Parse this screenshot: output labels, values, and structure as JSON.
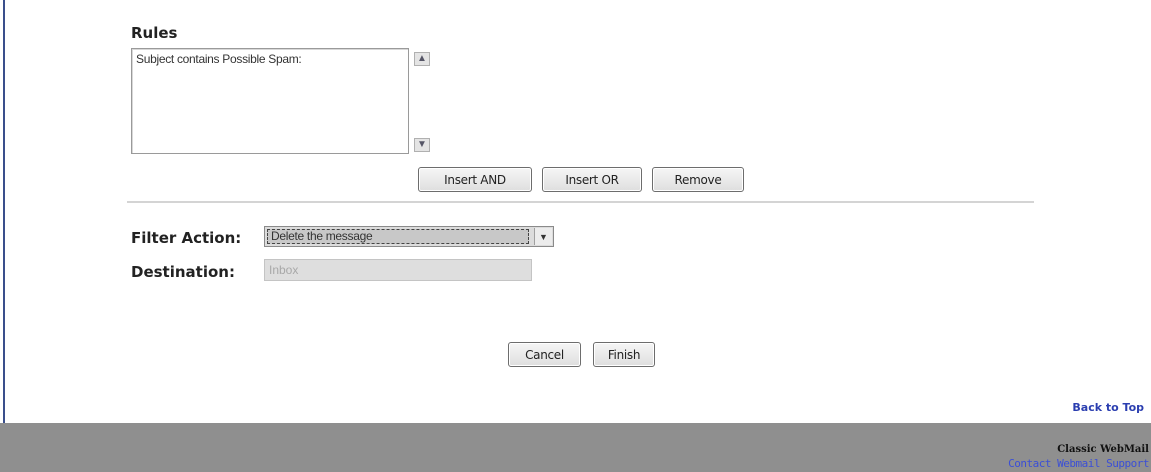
{
  "rules": {
    "title": "Rules",
    "items": [
      "Subject contains Possible Spam:"
    ],
    "scroll_up_icon": "chevron-up-icon",
    "scroll_down_icon": "chevron-down-icon"
  },
  "rule_buttons": {
    "insert_and": "Insert AND",
    "insert_or": "Insert OR",
    "remove": "Remove"
  },
  "filter_action": {
    "label": "Filter Action:",
    "selected": "Delete the message"
  },
  "destination": {
    "label": "Destination:",
    "value": "Inbox"
  },
  "form_buttons": {
    "cancel": "Cancel",
    "finish": "Finish"
  },
  "back_to_top": "Back to Top",
  "footer": {
    "brand": "Classic WebMail",
    "support_link": "Contact Webmail Support"
  },
  "colors": {
    "footer_bg": "#8f8f8f",
    "link": "#2b3eb0",
    "left_rule": "#3a4f8c"
  }
}
